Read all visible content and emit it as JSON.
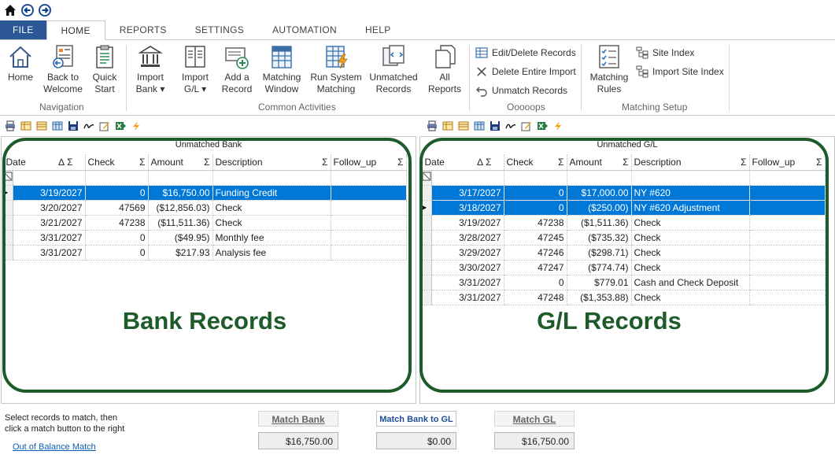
{
  "tabs": [
    {
      "label": "FILE"
    },
    {
      "label": "HOME"
    },
    {
      "label": "REPORTS"
    },
    {
      "label": "SETTINGS"
    },
    {
      "label": "AUTOMATION"
    },
    {
      "label": "HELP"
    }
  ],
  "ribbon": {
    "navigation": {
      "label": "Navigation",
      "home": "Home",
      "back1": "Back to",
      "back2": "Welcome",
      "quick1": "Quick",
      "quick2": "Start"
    },
    "common": {
      "label": "Common Activities",
      "import_bank1": "Import",
      "import_bank2": "Bank ▾",
      "import_gl1": "Import",
      "import_gl2": "G/L ▾",
      "add1": "Add a",
      "add2": "Record",
      "matching1": "Matching",
      "matching2": "Window",
      "run1": "Run System",
      "run2": "Matching",
      "unmatched1": "Unmatched",
      "unmatched2": "Records",
      "all1": "All",
      "all2": "Reports"
    },
    "ooops": {
      "label": "Ooooops",
      "edit": "Edit/Delete Records",
      "delete": "Delete Entire Import",
      "unmatch": "Unmatch Records"
    },
    "setup": {
      "label": "Matching Setup",
      "rules1": "Matching",
      "rules2": "Rules",
      "site_index": "Site Index",
      "import_site_index": "Import Site Index"
    }
  },
  "bank": {
    "title": "Unmatched Bank",
    "overlay": "Bank Records",
    "columns": [
      "Date",
      "Check",
      "Amount",
      "Description",
      "Follow_up"
    ],
    "rows": [
      {
        "date": "3/19/2027",
        "check": "0",
        "amount": "$16,750.00",
        "desc": "Funding Credit",
        "selected": true
      },
      {
        "date": "3/20/2027",
        "check": "47569",
        "amount": "($12,856.03)",
        "desc": "Check",
        "selected": false
      },
      {
        "date": "3/21/2027",
        "check": "47238",
        "amount": "($11,511.36)",
        "desc": "Check",
        "selected": false
      },
      {
        "date": "3/31/2027",
        "check": "0",
        "amount": "($49.95)",
        "desc": "Monthly fee",
        "selected": false
      },
      {
        "date": "3/31/2027",
        "check": "0",
        "amount": "$217.93",
        "desc": "Analysis fee",
        "selected": false
      }
    ]
  },
  "gl": {
    "title": "Unmatched G/L",
    "overlay": "G/L Records",
    "columns": [
      "Date",
      "Check",
      "Amount",
      "Description",
      "Follow_up"
    ],
    "rows": [
      {
        "date": "3/17/2027",
        "check": "0",
        "amount": "$17,000.00",
        "desc": "NY #620",
        "selected": true
      },
      {
        "date": "3/18/2027",
        "check": "0",
        "amount": "($250.00)",
        "desc": "NY #620 Adjustment",
        "selected": true
      },
      {
        "date": "3/19/2027",
        "check": "47238",
        "amount": "($1,511.36)",
        "desc": "Check",
        "selected": false
      },
      {
        "date": "3/28/2027",
        "check": "47245",
        "amount": "($735.32)",
        "desc": "Check",
        "selected": false
      },
      {
        "date": "3/29/2027",
        "check": "47246",
        "amount": "($298.71)",
        "desc": "Check",
        "selected": false
      },
      {
        "date": "3/30/2027",
        "check": "47247",
        "amount": "($774.74)",
        "desc": "Check",
        "selected": false
      },
      {
        "date": "3/31/2027",
        "check": "0",
        "amount": "$779.01",
        "desc": "Cash and Check Deposit",
        "selected": false
      },
      {
        "date": "3/31/2027",
        "check": "47248",
        "amount": "($1,353.88)",
        "desc": "Check",
        "selected": false
      }
    ]
  },
  "bottom": {
    "instruction1": "Select records to match, then",
    "instruction2": "click a match button to the right",
    "out_of_balance": "Out of Balance Match",
    "match_bank": "Match Bank",
    "match_bank_to_gl": "Match Bank to GL",
    "match_gl": "Match GL",
    "bank_total": "$16,750.00",
    "diff_total": "$0.00",
    "gl_total": "$16,750.00"
  },
  "colors": {
    "accent": "#2b5797",
    "selection": "#0078d7",
    "overlay_green": "#1e5b2b"
  }
}
